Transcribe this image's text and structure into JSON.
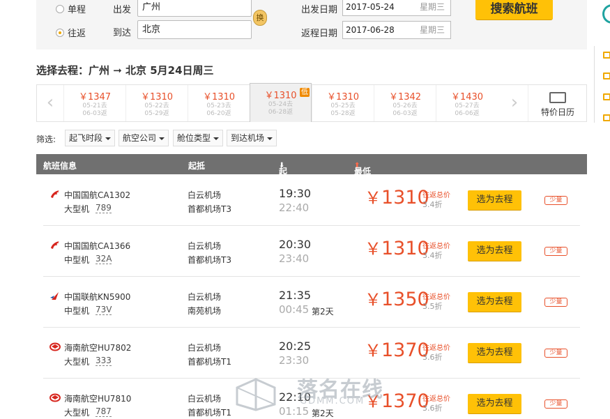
{
  "search": {
    "trip_types": [
      "单程",
      "往返"
    ],
    "selected_trip_type": "往返",
    "depart_label": "出发",
    "depart_city": "广州",
    "arrive_label": "到达",
    "arrive_city": "北京",
    "swap_label": "换",
    "depart_date_label": "出发日期",
    "depart_date": "2017-05-24",
    "depart_weekday": "星期三",
    "return_date_label": "返程日期",
    "return_date": "2017-06-28",
    "return_weekday": "星期三",
    "search_button": "搜索航班"
  },
  "route_title": "选择去程：广州 ➞ 北京  5月24日周三",
  "date_strip": [
    {
      "price": "￥1347",
      "depart": "05-21去",
      "return": "06-03返"
    },
    {
      "price": "￥1310",
      "depart": "05-22去",
      "return": "05-29返"
    },
    {
      "price": "￥1310",
      "depart": "05-23去",
      "return": "06-20返"
    },
    {
      "price": "￥1310",
      "depart": "05-24去",
      "return": "06-28返",
      "active": true,
      "badge": "低"
    },
    {
      "price": "￥1310",
      "depart": "05-25去",
      "return": "05-28返"
    },
    {
      "price": "￥1342",
      "depart": "05-26去",
      "return": "06-03返"
    },
    {
      "price": "￥1430",
      "depart": "05-27去",
      "return": "06-06返"
    }
  ],
  "calendar_label": "特价日历",
  "filter": {
    "label": "筛选:",
    "options": [
      "起飞时段",
      "航空公司",
      "舱位类型",
      "到达机场"
    ]
  },
  "table_header": {
    "flight_info": "航班信息",
    "takeoff_landing": "起抵",
    "time": "起抵时间",
    "time_sort": "⬇",
    "price": "最低价格（不含税费）",
    "price_sort": "⬆"
  },
  "rows_common": {
    "rt_label": "往返总价",
    "select_button": "选为去程",
    "few_label": "少量"
  },
  "flights": [
    {
      "airline": "中国国航CA1302",
      "logo": "air-china-icon",
      "size": "大型机",
      "model": "789",
      "dep_airport": "白云机场",
      "arr_airport": "首都机场T3",
      "dep_time": "19:30",
      "arr_time": "22:40",
      "next_day": "",
      "price": "1310",
      "discount": "3.4折"
    },
    {
      "airline": "中国国航CA1366",
      "logo": "air-china-icon",
      "size": "中型机",
      "model": "32A",
      "dep_airport": "白云机场",
      "arr_airport": "首都机场T3",
      "dep_time": "20:30",
      "arr_time": "23:40",
      "next_day": "",
      "price": "1310",
      "discount": "3.4折"
    },
    {
      "airline": "中国联航KN5900",
      "logo": "china-united-icon",
      "size": "中型机",
      "model": "73V",
      "dep_airport": "白云机场",
      "arr_airport": "南苑机场",
      "dep_time": "21:35",
      "arr_time": "00:45",
      "next_day": "第2天",
      "price": "1350",
      "discount": "3.5折"
    },
    {
      "airline": "海南航空HU7802",
      "logo": "hainan-airlines-icon",
      "size": "大型机",
      "model": "333",
      "dep_airport": "白云机场",
      "arr_airport": "首都机场T1",
      "dep_time": "20:25",
      "arr_time": "23:30",
      "next_day": "",
      "price": "1370",
      "discount": "3.6折"
    },
    {
      "airline": "海南航空HU7810",
      "logo": "hainan-airlines-icon",
      "size": "大型机",
      "model": "787",
      "dep_airport": "白云机场",
      "arr_airport": "首都机场T1",
      "dep_time": "22:10",
      "arr_time": "01:15",
      "next_day": "第2天",
      "price": "1370",
      "discount": "3.6折"
    }
  ],
  "watermark": {
    "cn": "落名在线",
    "en": "GDMM.COM"
  },
  "colors": {
    "accent": "#ffc107",
    "price": "#e8502a",
    "header": "#707070"
  }
}
